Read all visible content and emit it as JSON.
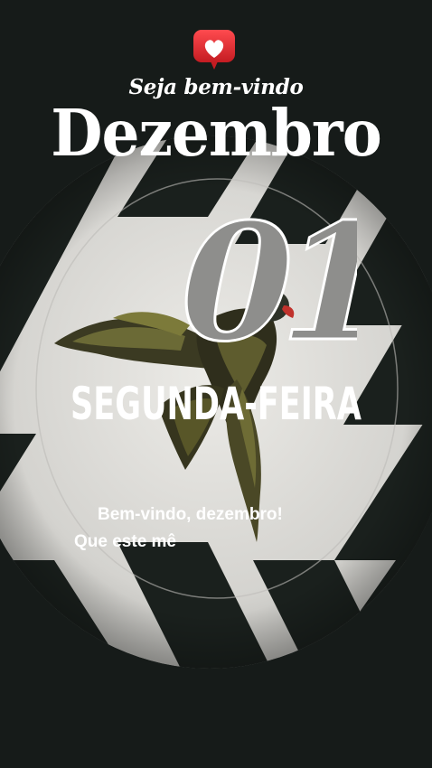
{
  "header": {
    "badge_icon": "heart-notification-icon",
    "welcome_text": "Seja bem-vindo",
    "month": "Dezembro"
  },
  "date": {
    "day": "01",
    "weekday": "SEGUNDA-FEIRA"
  },
  "message": {
    "line1": "Bem-vindo, dezembro!",
    "line2": "Que este mê"
  },
  "colors": {
    "background": "#161b19",
    "plate": "#d9d8d4",
    "stripe": "#1a201d",
    "badge": "#e8272c",
    "text": "#ffffff",
    "day_fill": "#8e8e8c"
  }
}
